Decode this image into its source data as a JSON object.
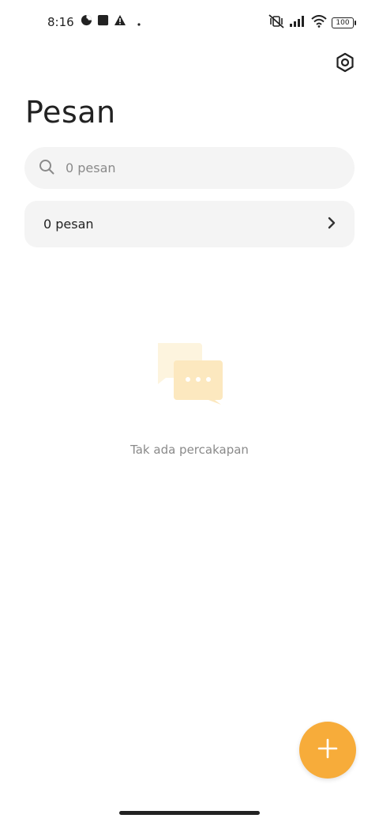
{
  "status_bar": {
    "time": "8:16",
    "battery": "100",
    "icons": [
      "data-saver-icon",
      "square-notification-icon",
      "warning-icon",
      "dot-icon",
      "mute-vibrate-icon",
      "signal-icon",
      "wifi-icon",
      "battery-icon"
    ]
  },
  "header": {
    "title": "Pesan",
    "settings_icon": "settings-hex-icon"
  },
  "search": {
    "placeholder": "0 pesan",
    "value": ""
  },
  "row": {
    "label": "0 pesan",
    "chevron_icon": "chevron-right-icon"
  },
  "empty_state": {
    "illustration": "chat-bubbles-icon",
    "message": "Tak ada percakapan"
  },
  "fab": {
    "icon": "plus-icon",
    "color": "#f7ac3a"
  },
  "colors": {
    "accent": "#f7ac3a",
    "surface": "#f4f4f4",
    "text_primary": "#222222",
    "text_secondary": "#8a8a8a"
  }
}
